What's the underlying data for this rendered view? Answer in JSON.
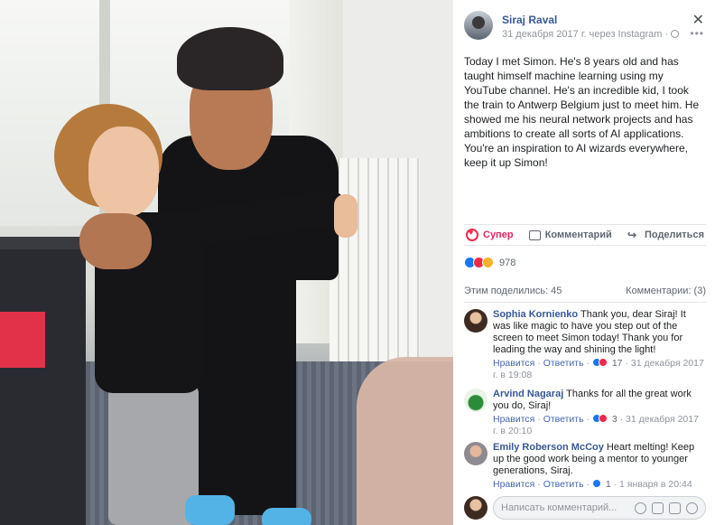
{
  "post": {
    "author": "Siraj Raval",
    "meta": "31 декабря 2017 г. через Instagram ·",
    "text": "Today I met Simon. He's 8 years old and has taught himself machine learning using my YouTube channel. He's an incredible kid, I took the train to Antwerp Belgium just to meet him. He showed me his neural network projects and has ambitions to create all sorts of AI applications. You're an inspiration to AI wizards everywhere, keep it up Simon!",
    "close_glyph": "✕",
    "more_glyph": "•••"
  },
  "actions": {
    "like_label": "Супер",
    "comment_label": "Комментарий",
    "share_label": "Поделиться"
  },
  "reactions": {
    "count": "978",
    "types": [
      "like",
      "love",
      "wow"
    ]
  },
  "shares_label": "Этим поделились: 45",
  "comments_label": "Комментарии: (3)",
  "comments": [
    {
      "name": "Sophia Kornienko",
      "text": "Thank you, dear Siraj! It was like magic to have you step out of the screen to meet Simon today! Thank you for leading the way and shining the light!",
      "like": "Нравится",
      "reply": "Ответить",
      "sep": "·",
      "reaction_count": "17",
      "time": "31 декабря 2017 г. в 19:08"
    },
    {
      "name": "Arvind Nagaraj",
      "text": "Thanks for all the great work you do, Siraj!",
      "like": "Нравится",
      "reply": "Ответить",
      "sep": "·",
      "reaction_count": "3",
      "time": "31 декабря 2017 г. в 20:10"
    },
    {
      "name": "Emily Roberson McCoy",
      "text": "Heart melting! Keep up the good work being a mentor to younger generations, Siraj.",
      "like": "Нравится",
      "reply": "Ответить",
      "sep": "·",
      "reaction_count": "1",
      "time": "1 января в 20:44"
    }
  ],
  "comment_input": {
    "placeholder": "Написать комментарий..."
  },
  "colors": {
    "link": "#385898",
    "like_active": "#e0245e",
    "secondary": "#90949c"
  }
}
